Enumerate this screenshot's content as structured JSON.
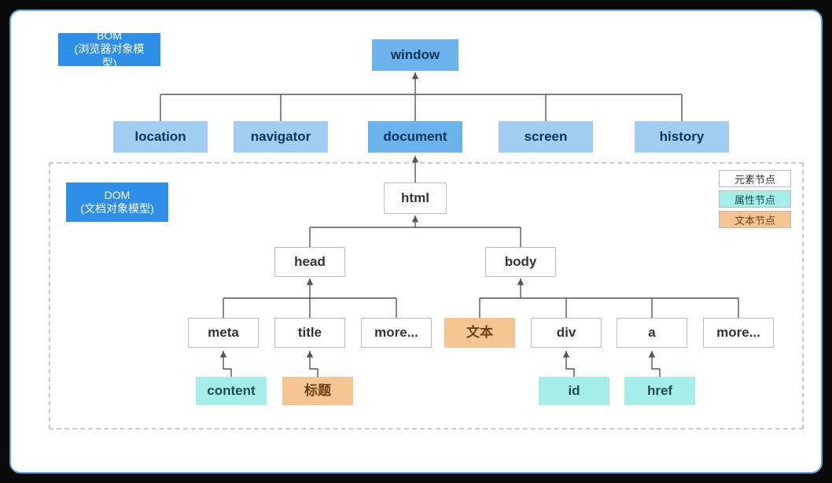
{
  "tags": {
    "bom": "BOM\n(浏览器对象模型)",
    "dom": "DOM\n(文档对象模型)"
  },
  "legend": {
    "elem": "元素节点",
    "attr": "属性节点",
    "text": "文本节点"
  },
  "nodes": {
    "window": "window",
    "location": "location",
    "navigator": "navigator",
    "document": "document",
    "screen": "screen",
    "history": "history",
    "html": "html",
    "head": "head",
    "body": "body",
    "meta": "meta",
    "title": "title",
    "head_more": "more...",
    "body_text": "文本",
    "div": "div",
    "a": "a",
    "body_more": "more...",
    "content": "content",
    "title_text": "标题",
    "id": "id",
    "href": "href"
  }
}
